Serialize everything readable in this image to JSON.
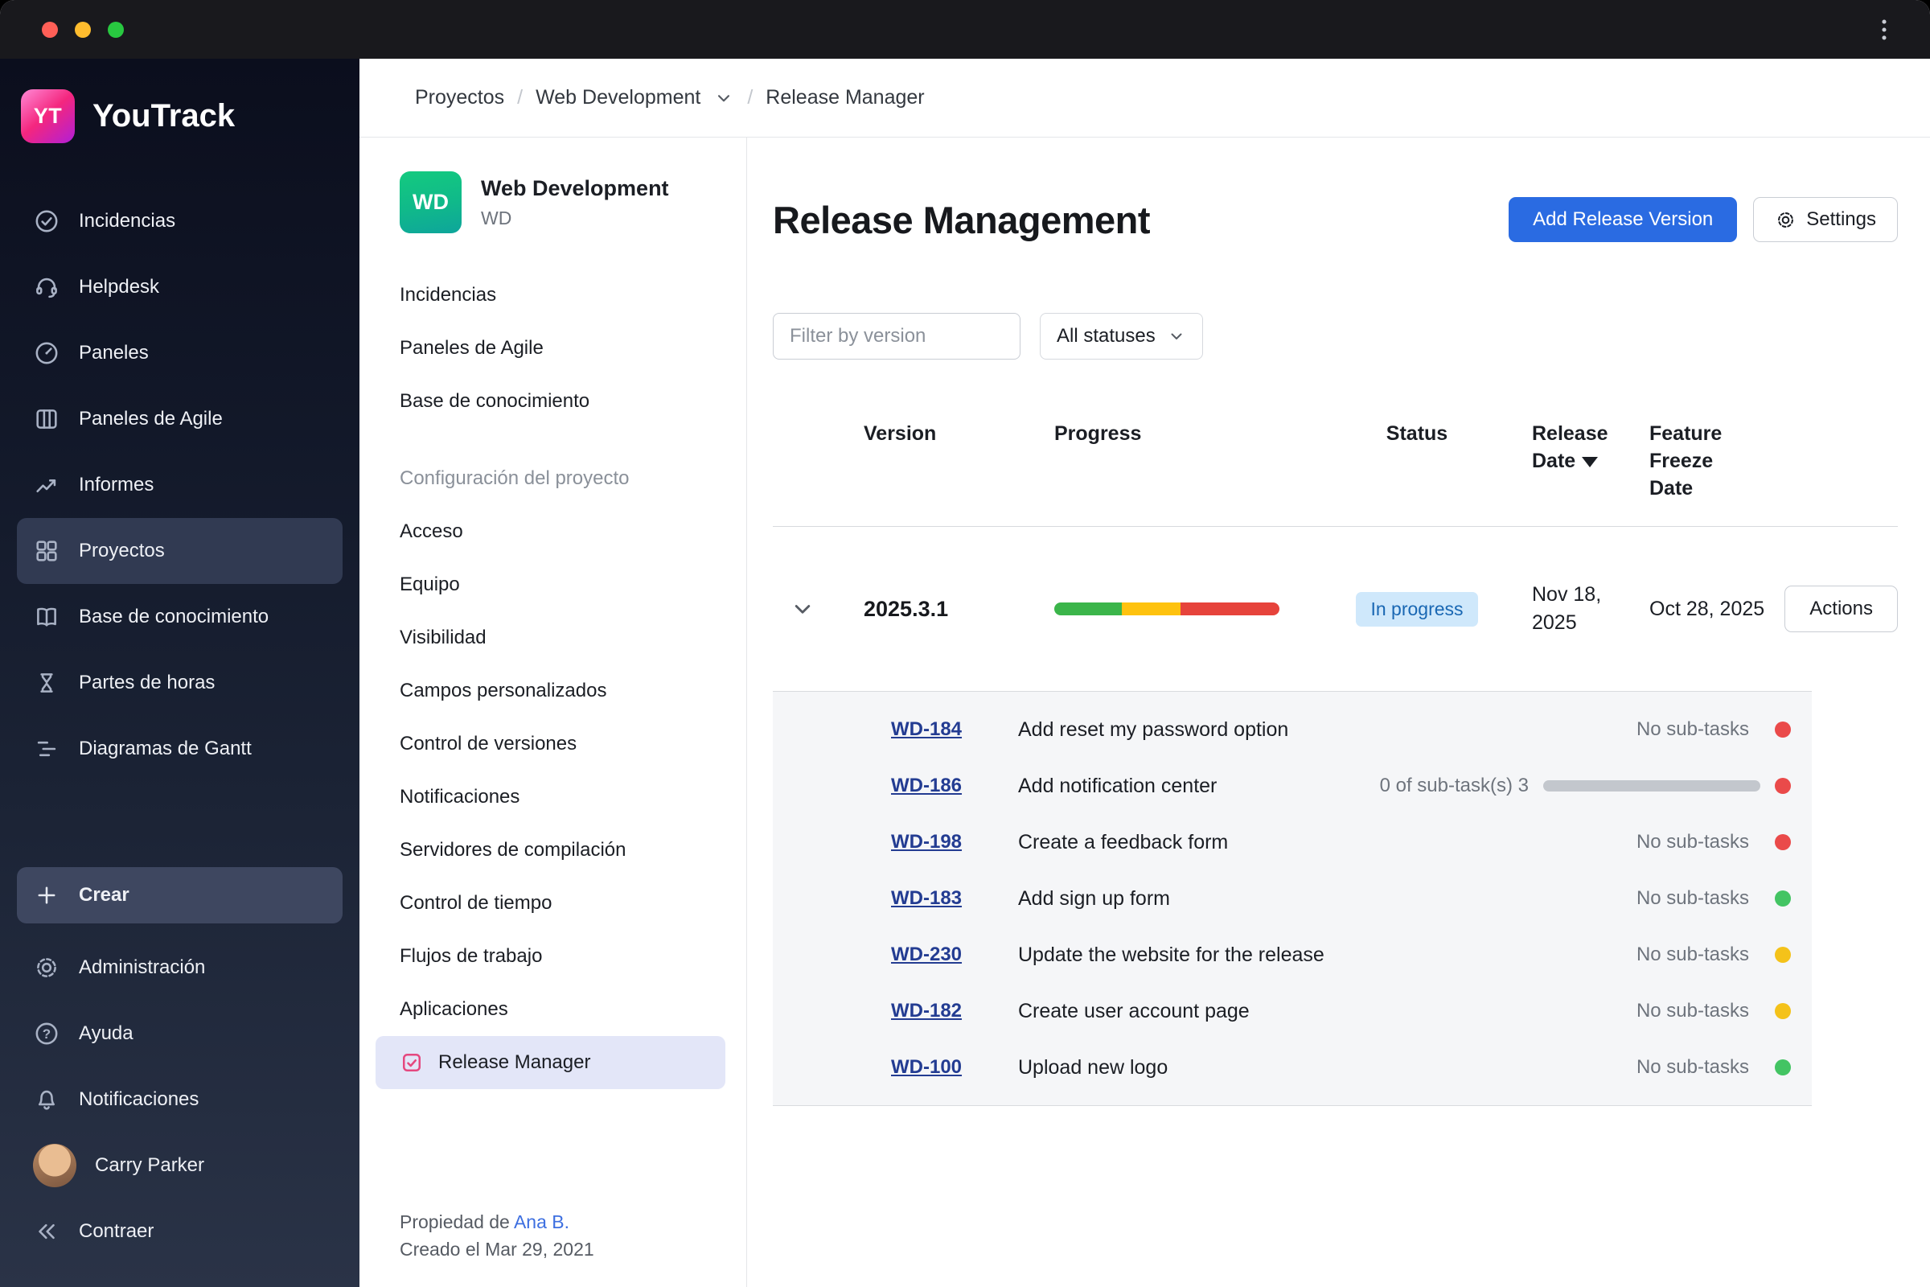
{
  "app_sidebar": {
    "logo_badge": "YT",
    "logo_text": "YouTrack",
    "items": [
      {
        "label": "Incidencias",
        "icon": "check-circle"
      },
      {
        "label": "Helpdesk",
        "icon": "headset"
      },
      {
        "label": "Paneles",
        "icon": "gauge"
      },
      {
        "label": "Paneles de Agile",
        "icon": "agile-board"
      },
      {
        "label": "Informes",
        "icon": "trend-chart"
      },
      {
        "label": "Proyectos",
        "icon": "grid",
        "selected": true
      },
      {
        "label": "Base de conocimiento",
        "icon": "book"
      },
      {
        "label": "Partes de horas",
        "icon": "hourglass"
      },
      {
        "label": "Diagramas de Gantt",
        "icon": "gantt-bars"
      }
    ],
    "create_button": "Crear",
    "bottom_items": [
      {
        "label": "Administración",
        "icon": "gear"
      },
      {
        "label": "Ayuda",
        "icon": "help-circle"
      },
      {
        "label": "Notificaciones",
        "icon": "bell"
      }
    ],
    "user": "Carry Parker",
    "collapse": "Contraer"
  },
  "breadcrumb": {
    "separator": "/",
    "items": [
      "Proyectos",
      "Web Development",
      "Release Manager"
    ]
  },
  "project_sidebar": {
    "avatar_text": "WD",
    "project_name": "Web Development",
    "project_key": "WD",
    "items_top": [
      "Incidencias",
      "Paneles de Agile",
      "Base de conocimiento"
    ],
    "section_title": "Configuración del proyecto",
    "items_config": [
      "Acceso",
      "Equipo",
      "Visibilidad",
      "Campos personalizados",
      "Control de versiones",
      "Notificaciones",
      "Servidores de compilación",
      "Control de tiempo",
      "Flujos de trabajo",
      "Aplicaciones",
      "Release Manager"
    ],
    "selected_item": "Release Manager",
    "footer_owner_prefix": "Propiedad de",
    "footer_owner_link": "Ana B.",
    "footer_created": "Creado el Mar 29, 2021"
  },
  "main": {
    "title": "Release Management",
    "add_button": "Add Release Version",
    "settings_button": "Settings",
    "filter_placeholder": "Filter by version",
    "status_filter": "All statuses",
    "table": {
      "columns": [
        "Version",
        "Progress",
        "Status",
        "Release Date",
        "Feature Freeze Date"
      ],
      "release": {
        "version": "2025.3.1",
        "progress": {
          "green": 30,
          "yellow": 26,
          "red": 44
        },
        "status": "In progress",
        "release_date": "Nov 18, 2025",
        "feature_freeze_date": "Oct 28, 2025",
        "actions_label": "Actions"
      },
      "subtasks": [
        {
          "id": "WD-184",
          "title": "Add reset my password option",
          "subtask_text": "No sub-tasks",
          "dot": "red"
        },
        {
          "id": "WD-186",
          "title": "Add notification center",
          "subtask_text": "0 of sub-task(s) 3",
          "has_bar": true,
          "dot": "red"
        },
        {
          "id": "WD-198",
          "title": "Create a feedback form",
          "subtask_text": "No sub-tasks",
          "dot": "red"
        },
        {
          "id": "WD-183",
          "title": "Add sign up form",
          "subtask_text": "No sub-tasks",
          "dot": "green"
        },
        {
          "id": "WD-230",
          "title": "Update the website for the release",
          "subtask_text": "No sub-tasks",
          "dot": "yellow"
        },
        {
          "id": "WD-182",
          "title": "Create user account page",
          "subtask_text": "No sub-tasks",
          "dot": "yellow"
        },
        {
          "id": "WD-100",
          "title": "Upload new logo",
          "subtask_text": "No sub-tasks",
          "dot": "green"
        }
      ]
    }
  },
  "colors": {
    "red": "#ea4a4a",
    "green": "#43c463",
    "yellow": "#f4c21a",
    "progress_green": "#3bb54a",
    "progress_yellow": "#fec20f",
    "progress_red": "#e6433b",
    "accent_blue": "#2a6be2",
    "badge_bg": "#cfe8fb",
    "badge_text": "#1967b3",
    "subtask_bar": "#c3c7cd"
  }
}
